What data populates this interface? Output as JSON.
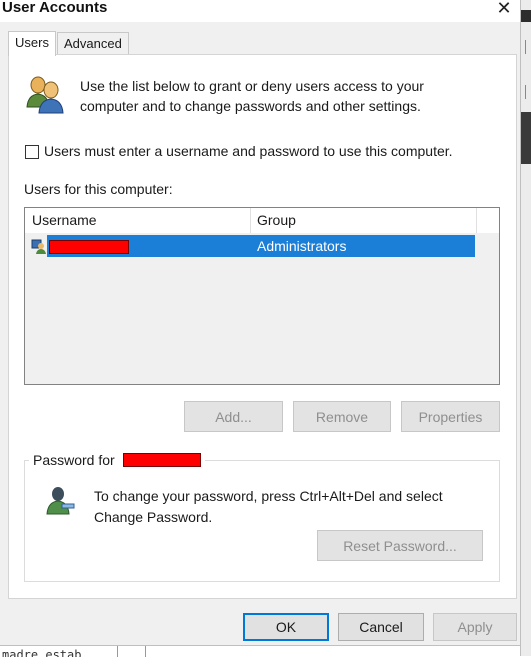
{
  "window": {
    "title": "User Accounts",
    "close_glyph": "✕"
  },
  "tabs": [
    {
      "label": "Users",
      "active": true
    },
    {
      "label": "Advanced",
      "active": false
    }
  ],
  "intro_text": "Use the list below to grant or deny users access to your computer and to change passwords and other settings.",
  "checkbox": {
    "label": "Users must enter a username and password to use this computer.",
    "checked": false
  },
  "users_section_label": "Users for this computer:",
  "table": {
    "columns": [
      "Username",
      "Group"
    ],
    "rows": [
      {
        "username": "",
        "group": "Administrators",
        "selected": true,
        "icon": "user-admin-icon"
      }
    ]
  },
  "list_buttons": {
    "add": "Add...",
    "remove": "Remove",
    "properties": "Properties"
  },
  "password_group": {
    "title": "Password for",
    "text": "To change your password, press Ctrl+Alt+Del and select Change Password.",
    "reset_button": "Reset Password..."
  },
  "dialog_buttons": {
    "ok": "OK",
    "cancel": "Cancel",
    "apply": "Apply"
  },
  "background_text": "madre estab",
  "colors": {
    "selection": "#1b7fd8",
    "redaction": "#ff0000",
    "default_button_border": "#0078d7"
  }
}
